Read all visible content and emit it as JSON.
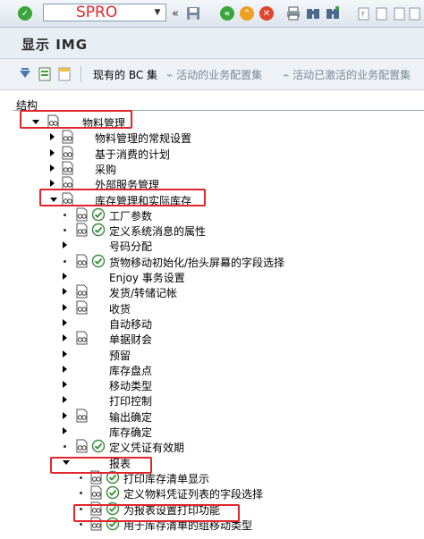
{
  "toolbar": {
    "command_value": "SPRO",
    "icons": [
      "enter-icon",
      "dropdown-icon",
      "back-arrows-icon",
      "save-icon",
      "back-icon",
      "exit-icon",
      "cancel-icon",
      "print-icon",
      "find-icon",
      "find-next-icon",
      "first-page-icon",
      "previous-page-icon",
      "next-page-icon",
      "last-page-icon"
    ]
  },
  "title": "显示 IMG",
  "appbar": {
    "existing_bc_sets": "现有的 BC 集",
    "active_bc_sets": "活动的业务配置集",
    "activated_bc_sets": "活动已激活的业务配置集"
  },
  "tree": {
    "header": "结构",
    "nodes": [
      {
        "label": "物料管理",
        "level": 0,
        "expand": "open",
        "glasses": true,
        "exec": false
      },
      {
        "label": "物料管理的常规设置",
        "level": 1,
        "expand": "closed",
        "glasses": true,
        "exec": false
      },
      {
        "label": "基于消费的计划",
        "level": 1,
        "expand": "closed",
        "glasses": true,
        "exec": false
      },
      {
        "label": "采购",
        "level": 1,
        "expand": "closed",
        "glasses": true,
        "exec": false
      },
      {
        "label": "外部服务管理",
        "level": 1,
        "expand": "closed",
        "glasses": true,
        "exec": false
      },
      {
        "label": "库存管理和实际库存",
        "level": 1,
        "expand": "open",
        "glasses": true,
        "exec": false
      },
      {
        "label": "工厂参数",
        "level": 2,
        "expand": "leaf",
        "glasses": true,
        "exec": true
      },
      {
        "label": "定义系统消息的属性",
        "level": 2,
        "expand": "leaf",
        "glasses": true,
        "exec": true
      },
      {
        "label": "号码分配",
        "level": 2,
        "expand": "closed",
        "glasses": false,
        "exec": false
      },
      {
        "label": "货物移动初始化/抬头屏幕的字段选择",
        "level": 2,
        "expand": "leaf",
        "glasses": true,
        "exec": true
      },
      {
        "label": "Enjoy 事务设置",
        "level": 2,
        "expand": "closed",
        "glasses": false,
        "exec": false
      },
      {
        "label": "发货/转储记帐",
        "level": 2,
        "expand": "closed",
        "glasses": true,
        "exec": false
      },
      {
        "label": "收货",
        "level": 2,
        "expand": "closed",
        "glasses": true,
        "exec": false
      },
      {
        "label": "自动移动",
        "level": 2,
        "expand": "closed",
        "glasses": false,
        "exec": false
      },
      {
        "label": "单据财会",
        "level": 2,
        "expand": "closed",
        "glasses": true,
        "exec": false
      },
      {
        "label": "预留",
        "level": 2,
        "expand": "closed",
        "glasses": false,
        "exec": false
      },
      {
        "label": "库存盘点",
        "level": 2,
        "expand": "closed",
        "glasses": false,
        "exec": false
      },
      {
        "label": "移动类型",
        "level": 2,
        "expand": "closed",
        "glasses": false,
        "exec": false
      },
      {
        "label": "打印控制",
        "level": 2,
        "expand": "closed",
        "glasses": false,
        "exec": false
      },
      {
        "label": "输出确定",
        "level": 2,
        "expand": "closed",
        "glasses": true,
        "exec": false
      },
      {
        "label": "库存确定",
        "level": 2,
        "expand": "closed",
        "glasses": false,
        "exec": false
      },
      {
        "label": "定义凭证有效期",
        "level": 2,
        "expand": "leaf",
        "glasses": true,
        "exec": true
      },
      {
        "label": "报表",
        "level": 2,
        "expand": "open",
        "glasses": false,
        "exec": false
      },
      {
        "label": "打印库存清单显示",
        "level": 3,
        "expand": "leaf",
        "glasses": true,
        "exec": true
      },
      {
        "label": "定义物料凭证列表的字段选择",
        "level": 3,
        "expand": "leaf",
        "glasses": true,
        "exec": true
      },
      {
        "label": "为报表设置打印功能",
        "level": 3,
        "expand": "leaf",
        "glasses": true,
        "exec": true
      },
      {
        "label": "用于库存清单的组移动类型",
        "level": 3,
        "expand": "leaf",
        "glasses": true,
        "exec": true
      }
    ]
  }
}
